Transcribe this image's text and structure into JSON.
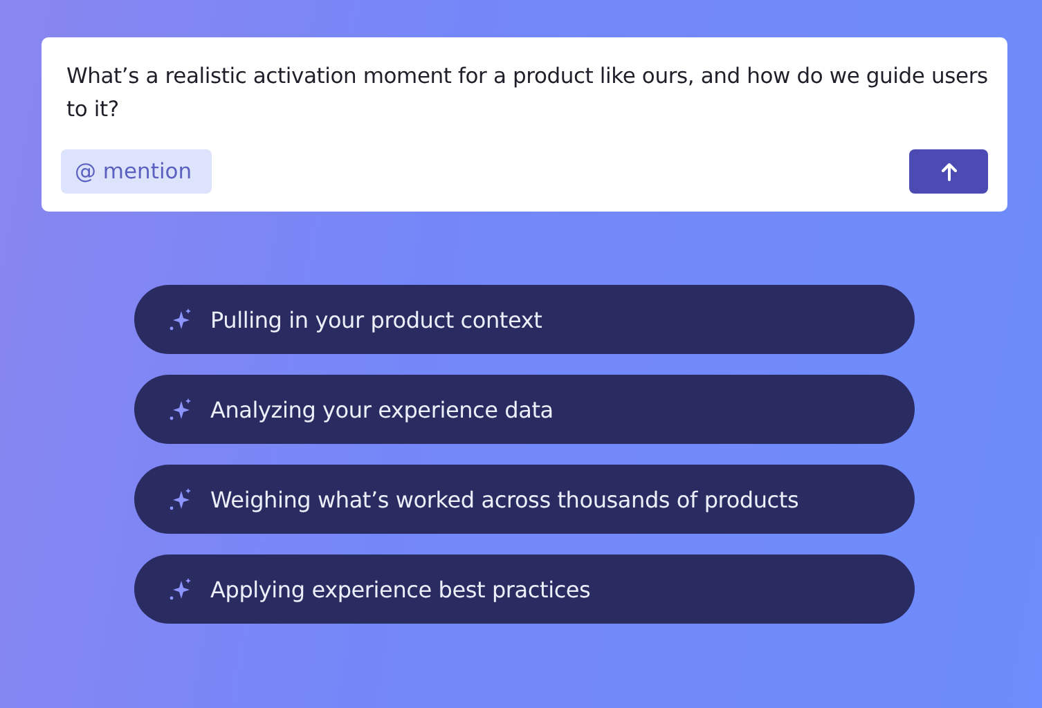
{
  "prompt": {
    "text": "What’s a realistic activation moment for a product like ours, and how do we guide users to it?",
    "mention_button": "@ mention"
  },
  "steps": [
    {
      "label": "Pulling in your product context"
    },
    {
      "label": "Analyzing your experience data"
    },
    {
      "label": "Weighing what’s worked across thousands of products"
    },
    {
      "label": "Applying experience best practices"
    }
  ]
}
